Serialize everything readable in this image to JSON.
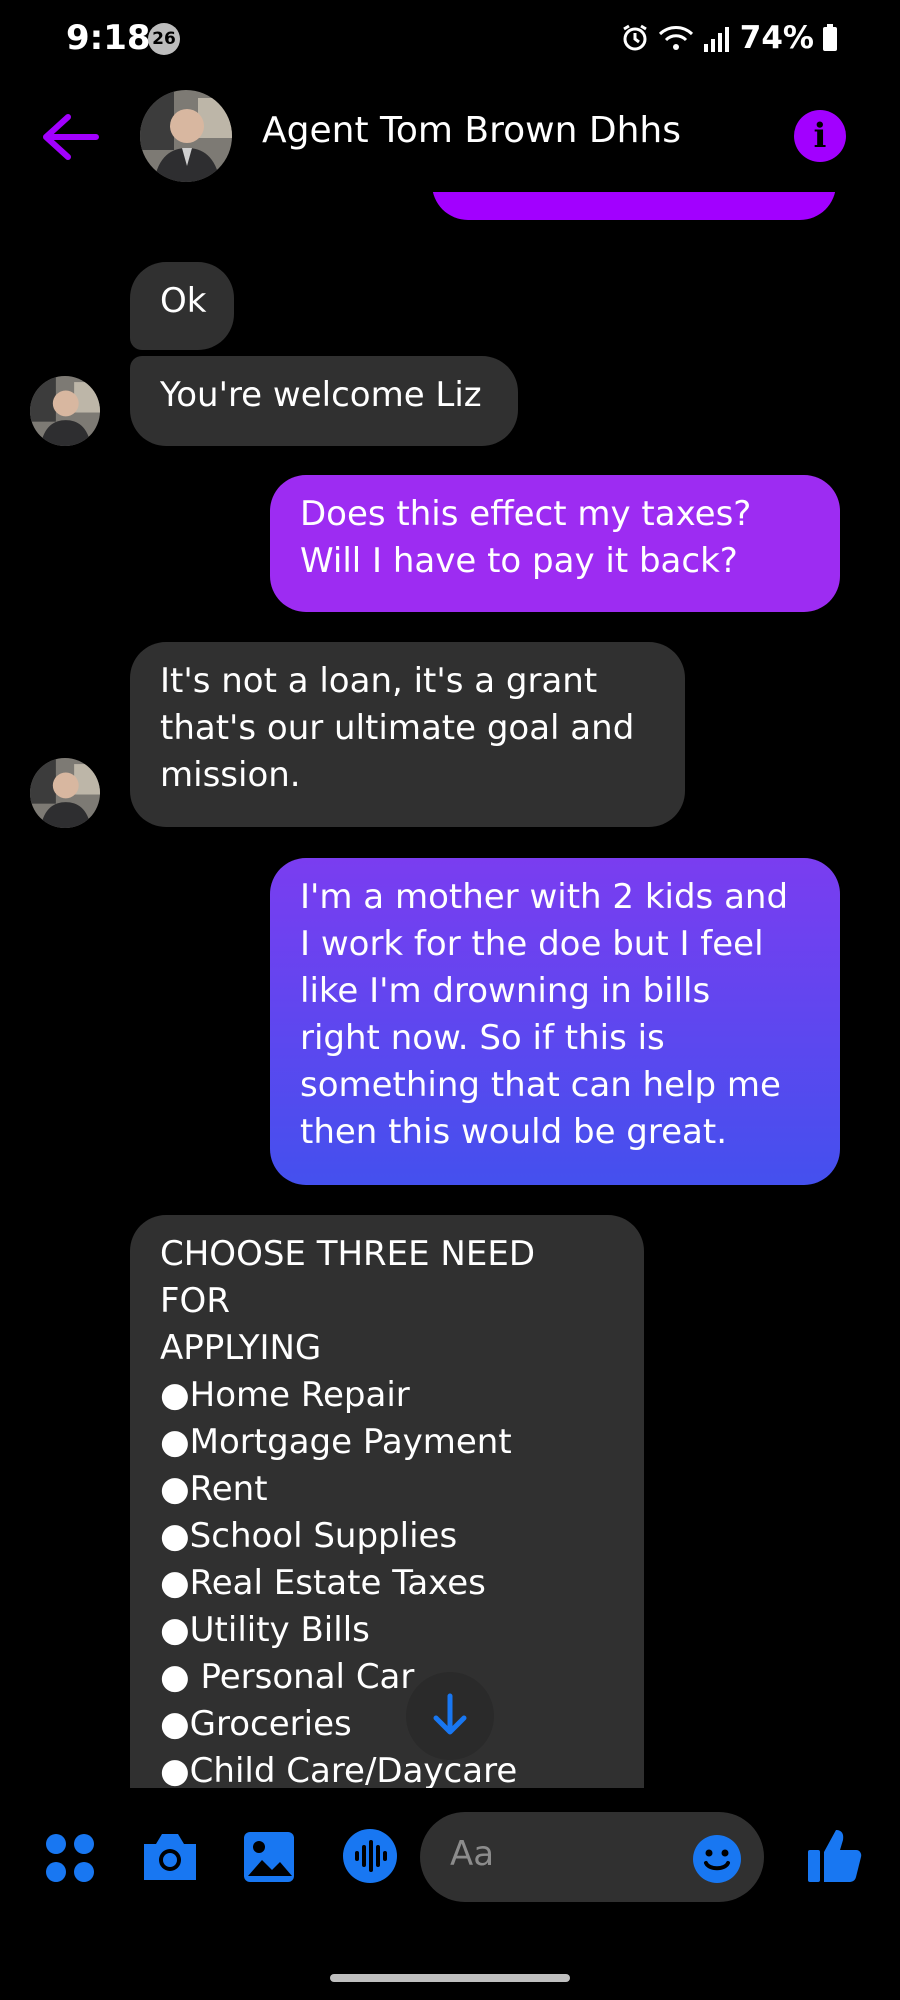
{
  "status_bar": {
    "time": "9:18",
    "notification_count": "26",
    "battery": "74%"
  },
  "header": {
    "contact_name": "Agent Tom Brown Dhhs",
    "info_label": "i"
  },
  "colors": {
    "accent": "#a200ff",
    "outgoing_top": "#9d2cf2",
    "outgoing_bottom": "#4450ee",
    "incoming": "#303030",
    "messenger_blue": "#1877f2"
  },
  "messages": [
    {
      "direction": "incoming",
      "text": "Ok"
    },
    {
      "direction": "incoming",
      "text": "You're welcome Liz"
    },
    {
      "direction": "outgoing",
      "text": "Does this effect my taxes?\nWill I have to pay it back?"
    },
    {
      "direction": "incoming",
      "text": "It's not a loan, it's a grant\nthat's our ultimate goal and\nmission."
    },
    {
      "direction": "outgoing",
      "text": "I'm a mother with 2 kids and\nI work for the doe but I feel\nlike I'm drowning in bills\nright now. So if this is\nsomething that can help me\nthen this would be great."
    },
    {
      "direction": "incoming",
      "text": "CHOOSE THREE NEED FOR\nAPPLYING\n●Home Repair\n●Mortgage Payment\n●Rent\n●School Supplies\n●Real Estate Taxes\n●Utility Bills\n● Personal Car\n●Groceries\n●Child Care/Daycare\n●Medical Bills"
    }
  ],
  "composer": {
    "placeholder": "Aa",
    "icons": [
      "apps-icon",
      "camera-icon",
      "gallery-icon",
      "voice-icon",
      "emoji-icon",
      "thumbs-up-icon"
    ]
  }
}
